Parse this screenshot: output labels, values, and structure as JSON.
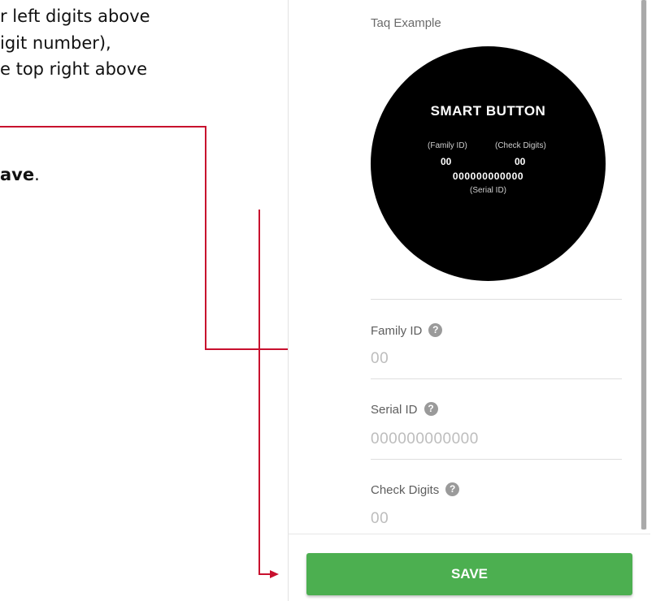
{
  "instructions": {
    "line1": "r left digits above",
    "line2": "igit number),",
    "line3": "e top right above",
    "line4_bold": "ave",
    "line4_rest": "."
  },
  "panel": {
    "tag_example_label": "Taq Example",
    "tag": {
      "title": "SMART BUTTON",
      "family_label": "(Family ID)",
      "check_label": "(Check Digits)",
      "family_value": "00",
      "check_value": "00",
      "serial_value": "000000000000",
      "serial_label": "(Serial ID)"
    },
    "fields": {
      "family_id": {
        "label": "Family ID",
        "help": "?",
        "placeholder": "00"
      },
      "serial_id": {
        "label": "Serial ID",
        "help": "?",
        "placeholder": "000000000000"
      },
      "check_digits": {
        "label": "Check Digits",
        "help": "?",
        "placeholder": "00"
      }
    },
    "save_label": "SAVE"
  },
  "colors": {
    "callout": "#c8102e",
    "save_button": "#4caf50",
    "tag_background": "#000000"
  }
}
